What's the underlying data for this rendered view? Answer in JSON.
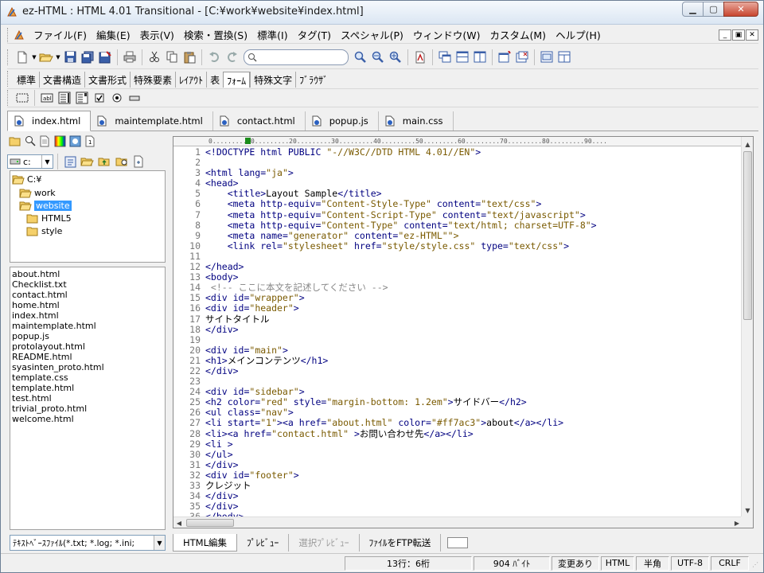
{
  "window": {
    "title": "ez-HTML : HTML 4.01 Transitional - [C:¥work¥website¥index.html]"
  },
  "menu": {
    "items": [
      "ファイル(F)",
      "編集(E)",
      "表示(V)",
      "検索・置換(S)",
      "標準(I)",
      "タグ(T)",
      "スペシャル(P)",
      "ウィンドウ(W)",
      "カスタム(M)",
      "ヘルプ(H)"
    ],
    "mdi": [
      "_",
      "▣",
      "✕"
    ]
  },
  "toolbar": {
    "search_value": "",
    "icons": [
      "new-file-icon",
      "open-folder-icon",
      "save-icon",
      "save-all-icon",
      "save-as-icon",
      "print-icon",
      "cut-icon",
      "copy-icon",
      "paste-icon",
      "undo-icon",
      "redo-icon",
      "search-icon",
      "find-next-icon",
      "find-prev-icon",
      "pdf-icon",
      "cascade-icon",
      "tile-horizontal-icon",
      "tile-vertical-icon",
      "new-window-icon",
      "close-window-icon",
      "split-icon",
      "layout-icon"
    ]
  },
  "tag_tabs": [
    "標準",
    "文書構造",
    "文書形式",
    "特殊要素",
    "ﾚｲｱｳﾄ",
    "表",
    "ﾌｫｰﾑ",
    "特殊文字",
    "ﾌﾞﾗｳｻﾞ"
  ],
  "tag_tabs_active": 6,
  "form_toolbar": [
    "form-icon",
    "textfield-icon",
    "textarea-icon",
    "select-icon",
    "checkbox-icon",
    "radio-icon",
    "button-icon"
  ],
  "doc_tabs": [
    {
      "label": "index.html",
      "active": true
    },
    {
      "label": "maintemplate.html",
      "active": false
    },
    {
      "label": "contact.html",
      "active": false
    },
    {
      "label": "popup.js",
      "active": false
    },
    {
      "label": "main.css",
      "active": false
    }
  ],
  "left_panel": {
    "drive": "c:",
    "tree": [
      {
        "label": "C:¥",
        "level": 0,
        "selected": false
      },
      {
        "label": "work",
        "level": 1,
        "selected": false
      },
      {
        "label": "website",
        "level": 1,
        "selected": true
      },
      {
        "label": "HTML5",
        "level": 2,
        "selected": false
      },
      {
        "label": "style",
        "level": 2,
        "selected": false
      }
    ],
    "files": [
      "about.html",
      "Checklist.txt",
      "contact.html",
      "home.html",
      "index.html",
      "maintemplate.html",
      "popup.js",
      "protolayout.html",
      "README.html",
      "syasinten_proto.html",
      "template.css",
      "template.html",
      "test.html",
      "trivial_proto.html",
      "welcome.html"
    ],
    "filter": "ﾃｷｽﾄﾍﾞｰｽﾌｧｲﾙ(*.txt; *.log; *.ini;"
  },
  "editor": {
    "ruler": "0.........10.........20.........30.........40.........50.........60.........70.........80.........90....",
    "lines": [
      "<!DOCTYPE html PUBLIC \"-//W3C//DTD HTML 4.01//EN\">",
      "",
      "<html lang=\"ja\">",
      "<head>",
      "    <title>Layout Sample</title>",
      "    <meta http-equiv=\"Content-Style-Type\" content=\"text/css\">",
      "    <meta http-equiv=\"Content-Script-Type\" content=\"text/javascript\">",
      "    <meta http-equiv=\"Content-Type\" content=\"text/html; charset=UTF-8\">",
      "    <meta name=\"generator\" content=\"ez-HTML\"\">",
      "    <link rel=\"stylesheet\" href=\"style/style.css\" type=\"text/css\">",
      "",
      "</head>",
      "<body>",
      " <!-- ここに本文を記述してください -->",
      "<div id=\"wrapper\">",
      "<div id=\"header\">",
      "サイトタイトル",
      "</div>",
      "",
      "<div id=\"main\">",
      "<h1>メインコンテンツ</h1>",
      "</div>",
      "",
      "<div id=\"sidebar\">",
      "<h2 color=\"red\" style=\"margin-bottom: 1.2em\">サイドバー</h2>",
      "<ul class=\"nav\">",
      "<li start=\"1\"><a href=\"about.html\" color=\"#ff7ac3\">about</a></li>",
      "<li><a href=\"contact.html\" >お問い合わせ先</a></li>",
      "<li >",
      "</ul>",
      "</div>",
      "<div id=\"footer\">",
      "クレジット",
      "</div>",
      "</div>",
      "</body>"
    ]
  },
  "bottom_tabs": [
    {
      "label": "HTML編集",
      "active": true,
      "disabled": false
    },
    {
      "label": "ﾌﾟﾚﾋﾞｭｰ",
      "active": false,
      "disabled": false
    },
    {
      "label": "選択ﾌﾟﾚﾋﾞｭｰ",
      "active": false,
      "disabled": true
    },
    {
      "label": "ﾌｧｲﾙをFTP転送",
      "active": false,
      "disabled": false
    }
  ],
  "status": [
    {
      "text": "13行：6桁",
      "width": 160
    },
    {
      "text": "904 ﾊﾞｲﾄ",
      "width": 96
    },
    {
      "text": "変更あり",
      "width": 60
    },
    {
      "text": "HTML",
      "width": 42
    },
    {
      "text": "半角",
      "width": 42
    },
    {
      "text": "UTF-8",
      "width": 48
    },
    {
      "text": "CRLF",
      "width": 48
    }
  ],
  "colors": {
    "selection": "#3399ff",
    "tag": "#000080",
    "string": "#7a5a00",
    "comment": "#888888"
  }
}
